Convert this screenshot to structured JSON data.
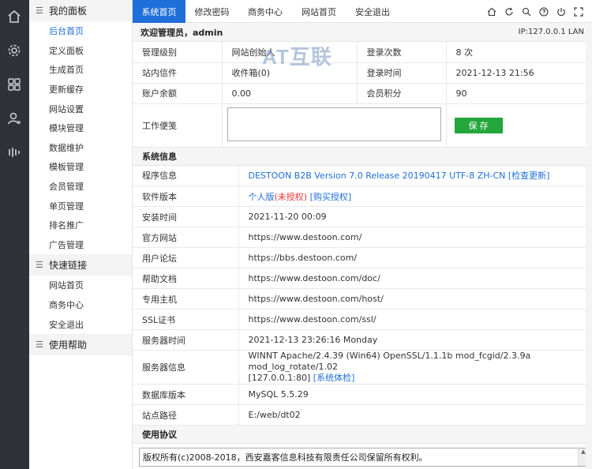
{
  "rail": {
    "icons": [
      "home-icon",
      "settings-icon",
      "grid-icon",
      "user-icon",
      "chart-icon"
    ]
  },
  "sidebar": {
    "groups": [
      {
        "title": "我的面板",
        "items": [
          "后台首页",
          "定义面板",
          "生成首页",
          "更新缓存",
          "网站设置",
          "模块管理",
          "数据维护",
          "模板管理",
          "会员管理",
          "单页管理",
          "排名推广",
          "广告管理"
        ]
      },
      {
        "title": "快速链接",
        "items": [
          "网站首页",
          "商务中心",
          "安全退出"
        ]
      },
      {
        "title": "使用帮助",
        "items": []
      }
    ]
  },
  "tabs": [
    "系统首页",
    "修改密码",
    "商务中心",
    "网站首页",
    "安全退出"
  ],
  "welcome": {
    "text": "欢迎管理员，admin",
    "ip": "IP:127.0.0.1 LAN"
  },
  "watermark": "AT互联",
  "account": {
    "level_label": "管理级别",
    "level_value": "网站创始人",
    "login_count_label": "登录次数",
    "login_count_value": "8 次",
    "inbox_label": "站内信件",
    "inbox_value": "收件箱(0)",
    "login_time_label": "登录时间",
    "login_time_value": "2021-12-13 21:56",
    "balance_label": "账户余额",
    "balance_value": "0.00",
    "points_label": "会员积分",
    "points_value": "90",
    "memo_label": "工作便笺",
    "save_label": "保 存"
  },
  "sysinfo_title": "系统信息",
  "sysinfo": [
    {
      "label": "程序信息",
      "value": "DESTOON B2B Version 7.0 Release 20190417 UTF-8 ZH-CN [检查更新]"
    },
    {
      "label": "软件版本",
      "value_a": "个人版",
      "value_b": "(未授权)",
      "value_c": "[购买授权]"
    },
    {
      "label": "安装时间",
      "value": "2021-11-20 00:09"
    },
    {
      "label": "官方网站",
      "value": "https://www.destoon.com/"
    },
    {
      "label": "用户论坛",
      "value": "https://bbs.destoon.com/"
    },
    {
      "label": "帮助文档",
      "value": "https://www.destoon.com/doc/"
    },
    {
      "label": "专用主机",
      "value": "https://www.destoon.com/host/"
    },
    {
      "label": "SSL证书",
      "value": "https://www.destoon.com/ssl/"
    },
    {
      "label": "服务器时间",
      "value": "2021-12-13 23:26:16 Monday"
    },
    {
      "label": "服务器信息",
      "value_a": "WINNT Apache/2.4.39 (Win64) OpenSSL/1.1.1b mod_fcgid/2.3.9a mod_log_rotate/1.02",
      "value_b": "[127.0.0.1:80]",
      "value_c": "[系统体检]"
    },
    {
      "label": "数据库版本",
      "value": "MySQL 5.5.29"
    },
    {
      "label": "站点路径",
      "value": "E:/web/dt02"
    }
  ],
  "agreement_title": "使用协议",
  "agreement_text": "版权所有(c)2008-2018，西安嘉客信息科技有限责任公司保留所有权利。"
}
